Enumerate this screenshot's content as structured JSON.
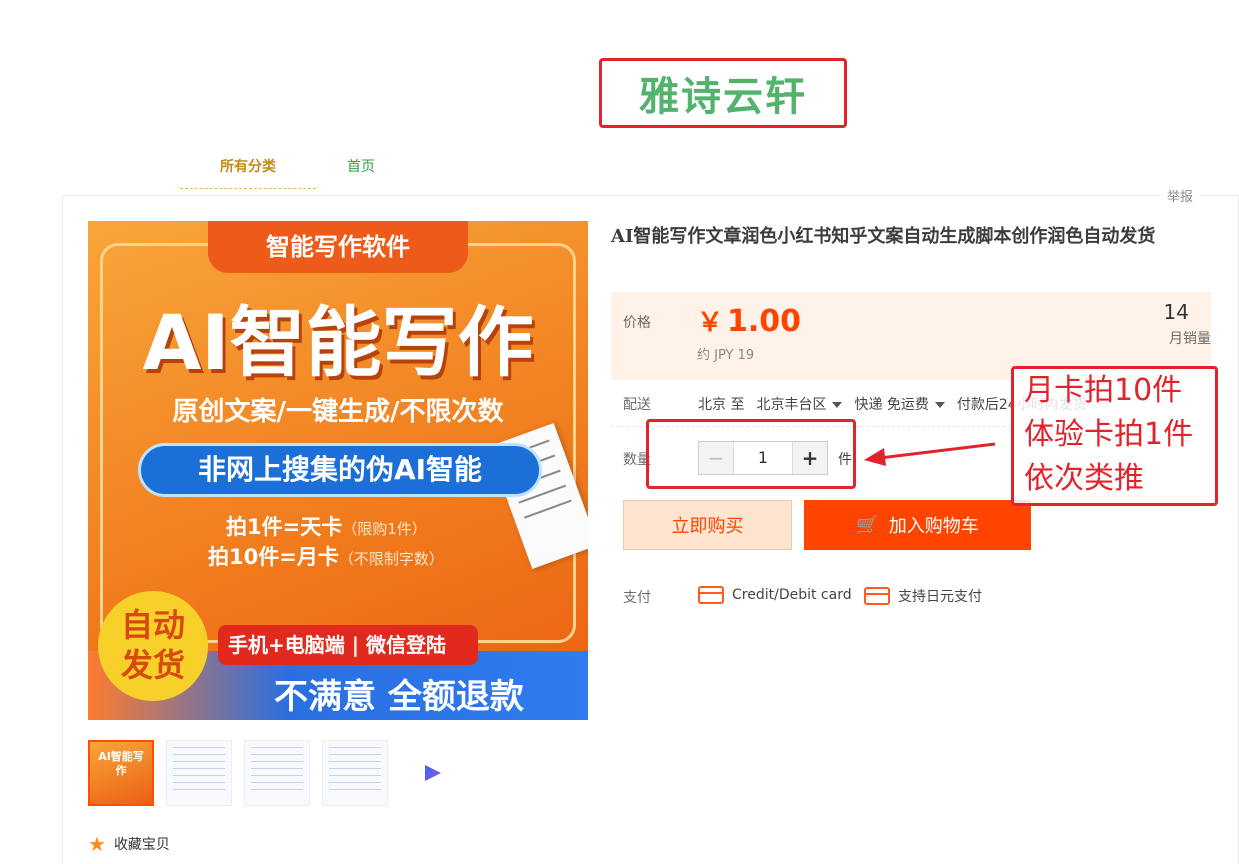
{
  "store": {
    "logo_text": "雅诗云轩"
  },
  "nav": {
    "all_categories": "所有分类",
    "home": "首页"
  },
  "report": "举报",
  "product": {
    "image": {
      "top_banner": "智能写作软件",
      "headline": "AI智能写作",
      "sub": "原创文案/一键生成/不限次数",
      "pill": "非网上搜集的伪AI智能",
      "line1": "拍1件=天卡",
      "line1_note": "（限购1件）",
      "line2": "拍10件=月卡",
      "line2_note": "（不限制字数）",
      "badge_line1": "自动",
      "badge_line2": "发货",
      "device_bar": "手机+电脑端 | 微信登陆",
      "refund": "不满意 全额退款"
    },
    "thumb_active_text": "AI智能写作",
    "favorite": "收藏宝贝",
    "title": "AI智能写作文章润色小红书知乎文案自动生成脚本创作润色自动发货",
    "price_label": "价格",
    "currency": "￥",
    "price": "1.00",
    "approx": "约 JPY 19",
    "sales_count": "14",
    "sales_label": "月销量",
    "shipping_label": "配送",
    "ship_from": "北京 至",
    "ship_to": "北京丰台区",
    "ship_method": "快递 免运费",
    "ship_time": "付款后24小时内发货",
    "quantity_label": "数量",
    "quantity": "1",
    "minus": "−",
    "plus": "+",
    "unit": "件",
    "buy_now": "立即购买",
    "add_to_cart": "加入购物车",
    "payment_label": "支付",
    "payment_options": [
      "Credit/Debit card",
      "支持日元支付"
    ]
  },
  "annotation": {
    "lines": [
      "月卡拍10件",
      "体验卡拍1件",
      "依次类推"
    ],
    "color": "#e3232b"
  },
  "colors": {
    "accent": "#ff4400",
    "brand_green": "#52b36b"
  }
}
